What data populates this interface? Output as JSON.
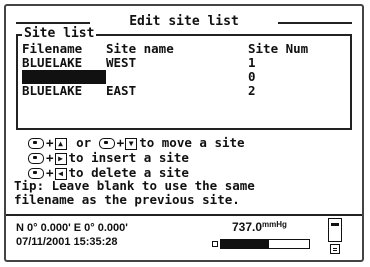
{
  "title": "Edit site list",
  "group_title": "Site list",
  "columns": [
    "Filename",
    "Site name",
    "Site Num"
  ],
  "rows": [
    {
      "filename": "BLUELAKE",
      "site_name": "WEST",
      "site_num": "1",
      "selected": false
    },
    {
      "filename": "",
      "site_name": "",
      "site_num": "0",
      "selected": true
    },
    {
      "filename": "BLUELAKE",
      "site_name": "EAST",
      "site_num": "2",
      "selected": false
    }
  ],
  "help": [
    {
      "icon": "key+up",
      "text": "or"
    },
    {
      "icon": "key+down",
      "text": "to move a site"
    },
    {
      "icon": "key+right",
      "text": "to insert a site"
    },
    {
      "icon": "key+left",
      "text": "to delete a site"
    }
  ],
  "tip_line1": "Tip: Leave blank to use the same",
  "tip_line2": "filename as the previous site.",
  "status": {
    "coords": "N 0° 0.000' E 0° 0.000'",
    "datetime": "07/11/2001 15:35:28",
    "pressure": "737.0",
    "pressure_unit": "mmHg",
    "level_fraction": 0.55
  }
}
